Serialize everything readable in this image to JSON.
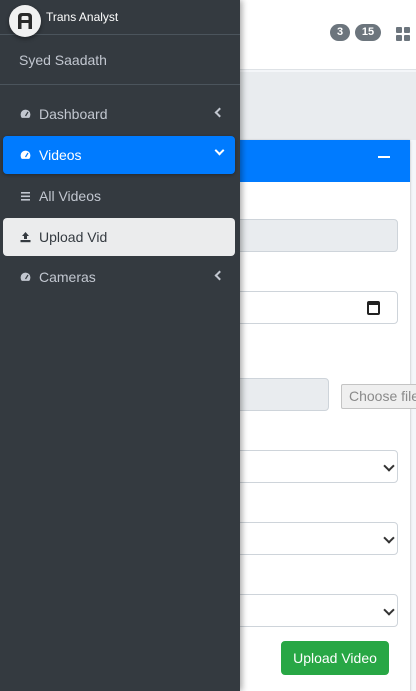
{
  "brand": {
    "name": "Trans Analyst",
    "logo_icon": "logo-icon"
  },
  "user": {
    "name": "Syed Saadath"
  },
  "header": {
    "badge_count_1": "3",
    "badge_count_2": "15"
  },
  "sidebar": {
    "items": [
      {
        "label": "Dashboard",
        "icon": "tachometer-icon",
        "state": "collapsed"
      },
      {
        "label": "Videos",
        "icon": "tachometer-icon",
        "state": "expanded",
        "active": true
      },
      {
        "label": "All Videos",
        "icon": "list-icon"
      },
      {
        "label": "Upload Vid",
        "icon": "upload-icon",
        "selected": true
      },
      {
        "label": "Cameras",
        "icon": "tachometer-icon",
        "state": "collapsed"
      }
    ]
  },
  "form": {
    "file_button_label": "Choose file",
    "submit_label": "Upload Video"
  },
  "colors": {
    "sidebar_bg": "#343a40",
    "primary": "#007bff",
    "success": "#28a745",
    "sidebar_text": "#c2c7d0"
  }
}
